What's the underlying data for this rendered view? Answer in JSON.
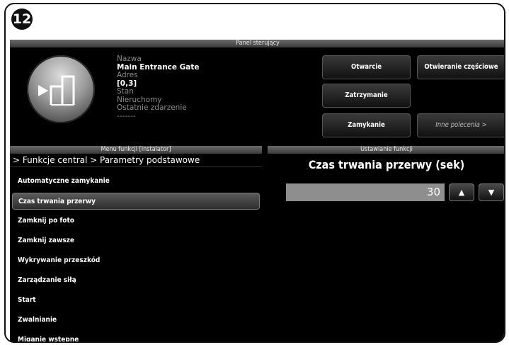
{
  "step_number": "12",
  "header": {
    "title": "Panel sterujący"
  },
  "device": {
    "icon": "gate-icon",
    "name_label": "Nazwa",
    "name_value": "Main Entrance Gate",
    "address_label": "Adres",
    "address_value": "[0,3]",
    "state_label": "Stan",
    "state_value": "Nieruchomy",
    "last_event_label": "Ostatnie zdarzenie",
    "last_event_value": "-------"
  },
  "commands": {
    "open": "Otwarcie",
    "partial_open": "Otwieranie częściowe",
    "stop": "Zatrzymanie",
    "close": "Zamykanie",
    "other": "Inne polecenia >"
  },
  "menu": {
    "title": "Menu funkcji [Instalator]",
    "breadcrumb": "> Funkcje central > Parametry podstawowe",
    "items": [
      "Automatyczne zamykanie",
      "Czas trwania przerwy",
      "Zamknij po foto",
      "Zamknij zawsze",
      "Wykrywanie przeszkód",
      "Zarządzanie siłą",
      "Start",
      "Zwalnianie",
      "Miganie wstępne"
    ],
    "selected_index": 1
  },
  "settings": {
    "title": "Ustawianie funkcji",
    "function_title": "Czas trwania przerwy  (sek)",
    "value": "30",
    "up_icon": "arrow-up-icon",
    "down_icon": "arrow-down-icon"
  }
}
